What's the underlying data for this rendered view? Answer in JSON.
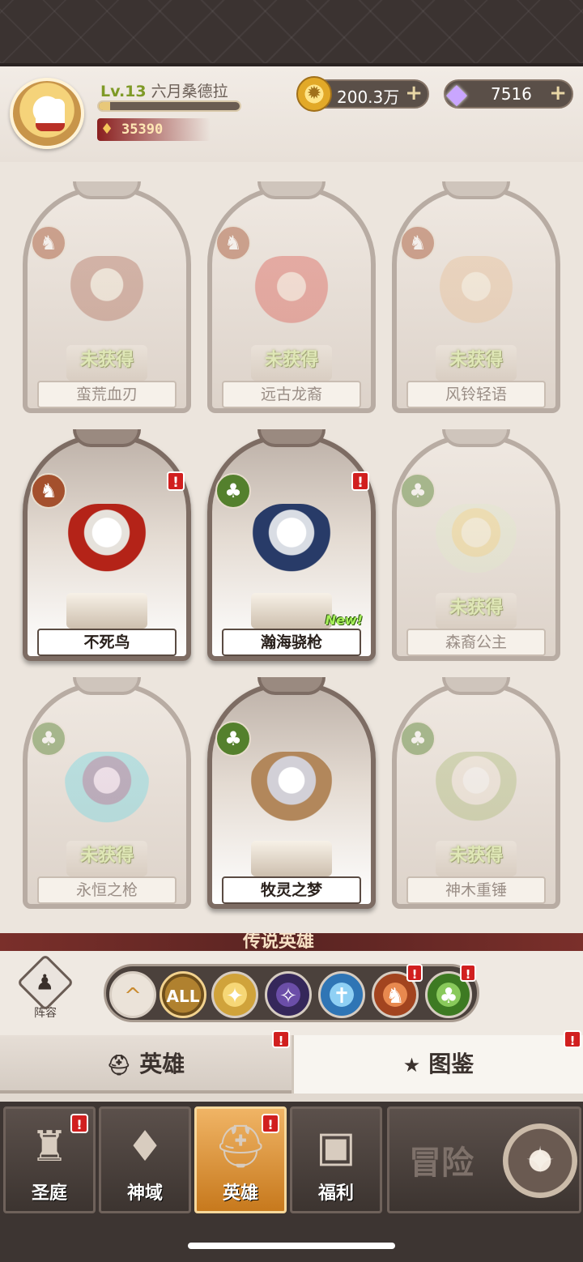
{
  "player": {
    "level_prefix": "Lv.13",
    "name": "六月桑德拉",
    "exp_fraction": 0.08,
    "power": "35390"
  },
  "currency": {
    "gold": "200.3万",
    "gems": "7516"
  },
  "heroes": [
    {
      "name": "蛮荒血刃",
      "faction": "fox-icon",
      "owned": false,
      "status": "未获得"
    },
    {
      "name": "远古龙裔",
      "faction": "fox-icon",
      "owned": false,
      "status": "未获得"
    },
    {
      "name": "风铃轻语",
      "faction": "fox-icon",
      "owned": false,
      "status": "未获得"
    },
    {
      "name": "不死鸟",
      "faction": "fox-icon",
      "owned": true,
      "alert": "!"
    },
    {
      "name": "瀚海骁枪",
      "faction": "tree-icon",
      "owned": true,
      "alert": "!",
      "new_tag": "New!"
    },
    {
      "name": "森裔公主",
      "faction": "tree-icon",
      "owned": false,
      "status": "未获得"
    },
    {
      "name": "永恒之枪",
      "faction": "tree-icon",
      "owned": false,
      "status": "未获得"
    },
    {
      "name": "牧灵之梦",
      "faction": "tree-icon",
      "owned": true
    },
    {
      "name": "神木重锤",
      "faction": "tree-icon",
      "owned": false,
      "status": "未获得"
    }
  ],
  "legend_banner": "传说英雄",
  "formation_label": "阵容",
  "filters": {
    "all_label": "ALL",
    "alert": "!"
  },
  "subtabs": {
    "hero": "英雄",
    "codex": "图鉴",
    "alert": "!"
  },
  "nav": {
    "items": [
      "圣庭",
      "神域",
      "英雄",
      "福利"
    ],
    "adventure": "冒险",
    "alert": "!"
  }
}
